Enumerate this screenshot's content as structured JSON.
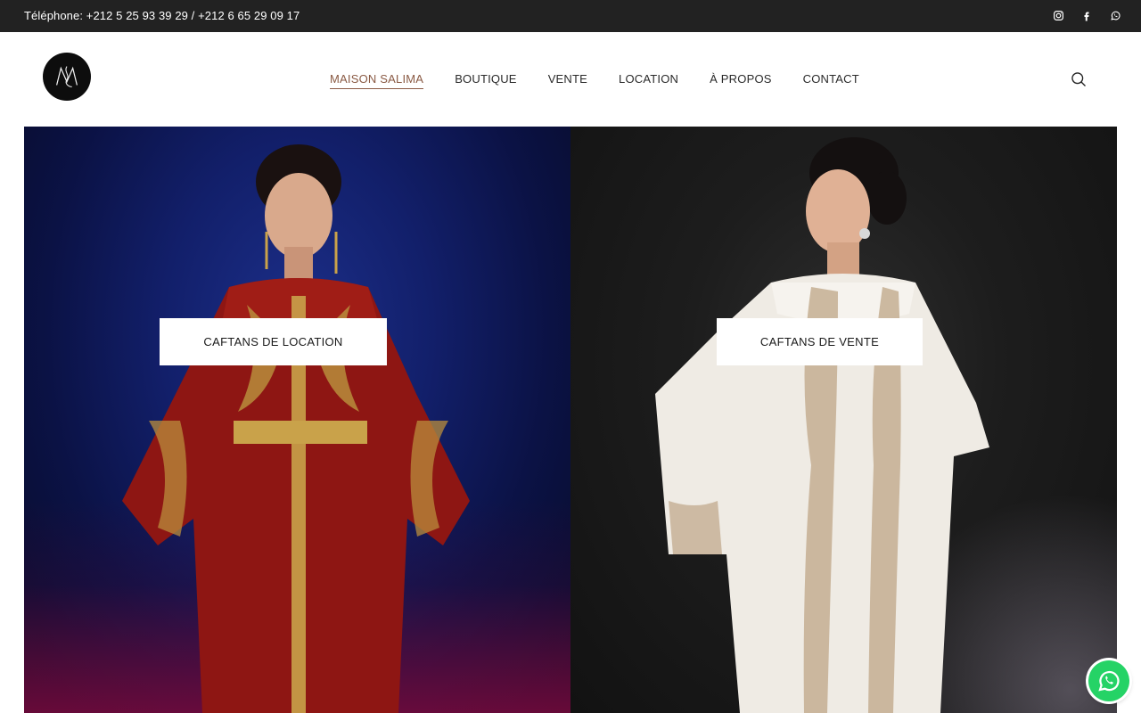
{
  "topbar": {
    "phone_text": "Téléphone: +212 5 25 93 39 29 / +212 6 65 29 09 17",
    "socials": [
      "instagram-icon",
      "facebook-icon",
      "whatsapp-icon"
    ]
  },
  "header": {
    "logo_letters": "MS",
    "nav": [
      {
        "label": "MAISON SALIMA",
        "active": true
      },
      {
        "label": "BOUTIQUE",
        "active": false
      },
      {
        "label": "VENTE",
        "active": false
      },
      {
        "label": "LOCATION",
        "active": false
      },
      {
        "label": "À PROPOS",
        "active": false
      },
      {
        "label": "CONTACT",
        "active": false
      }
    ],
    "search_icon": "search-icon"
  },
  "hero": {
    "left_button": "CAFTANS DE LOCATION",
    "right_button": "CAFTANS DE VENTE"
  },
  "floating": {
    "whatsapp_icon": "whatsapp-icon"
  },
  "colors": {
    "topbar_bg": "#222222",
    "nav_active": "#8a5a44",
    "whatsapp": "#25d366"
  }
}
